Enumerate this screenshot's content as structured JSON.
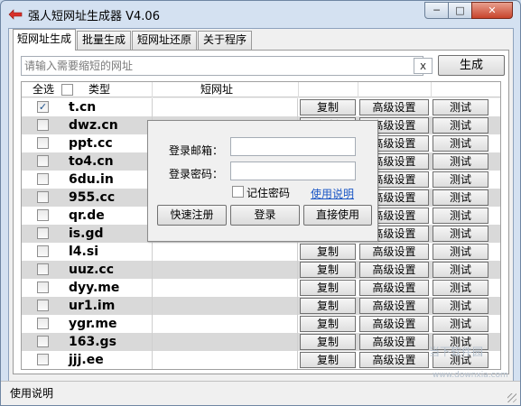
{
  "window": {
    "title": "强人短网址生成器 V4.06"
  },
  "tabs": [
    {
      "label": "短网址生成"
    },
    {
      "label": "批量生成"
    },
    {
      "label": "短网址还原"
    },
    {
      "label": "关于程序"
    }
  ],
  "input": {
    "placeholder": "请输入需要缩短的网址",
    "clear": "x",
    "generate": "生成"
  },
  "grid": {
    "headers": {
      "select_all": "全选",
      "type": "类型",
      "short": "短网址"
    },
    "copy": "复制",
    "advanced": "高级设置",
    "test": "测试",
    "rows": [
      {
        "domain": "t.cn",
        "checked": "✓"
      },
      {
        "domain": "dwz.cn",
        "checked": ""
      },
      {
        "domain": "ppt.cc",
        "checked": ""
      },
      {
        "domain": "to4.cn",
        "checked": ""
      },
      {
        "domain": "6du.in",
        "checked": ""
      },
      {
        "domain": "955.cc",
        "checked": ""
      },
      {
        "domain": "qr.de",
        "checked": ""
      },
      {
        "domain": "is.gd",
        "checked": ""
      },
      {
        "domain": "l4.si",
        "checked": ""
      },
      {
        "domain": "uuz.cc",
        "checked": ""
      },
      {
        "domain": "dyy.me",
        "checked": ""
      },
      {
        "domain": "ur1.im",
        "checked": ""
      },
      {
        "domain": "ygr.me",
        "checked": ""
      },
      {
        "domain": "163.gs",
        "checked": ""
      },
      {
        "domain": "jjj.ee",
        "checked": ""
      }
    ]
  },
  "login": {
    "email_label": "登录邮箱：",
    "password_label": "登录密码：",
    "remember": "记住密码",
    "help_link": "使用说明",
    "register": "快速注册",
    "login": "登录",
    "direct": "直接使用"
  },
  "status": {
    "text": "使用说明"
  },
  "watermark": {
    "brand": "当下软件园",
    "url": "www.downxia.com"
  }
}
